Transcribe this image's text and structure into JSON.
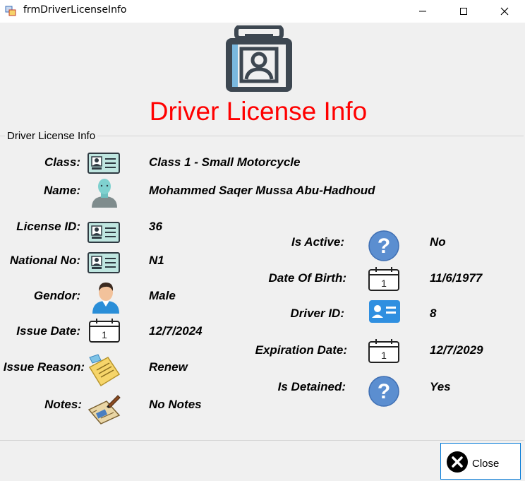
{
  "window": {
    "title": "frmDriverLicenseInfo",
    "controls": {
      "minimize": "minimize-icon",
      "maximize": "maximize-icon",
      "close": "close-icon"
    }
  },
  "header": {
    "title": "Driver License Info",
    "icon": "license-card-icon",
    "title_color": "#ff0000"
  },
  "group": {
    "label": "Driver License Info"
  },
  "left_fields": [
    {
      "label": "Class:",
      "value": "Class 1 - Small Motorcycle",
      "icon": "id-card-icon"
    },
    {
      "label": "Name:",
      "value": "Mohammed Saqer Mussa Abu-Hadhoud",
      "icon": "person-photo-icon"
    },
    {
      "label": "License ID:",
      "value": "36",
      "icon": "id-card-icon"
    },
    {
      "label": "National No:",
      "value": "N1",
      "icon": "id-card-icon"
    },
    {
      "label": "Gendor:",
      "value": "Male",
      "icon": "male-person-icon"
    },
    {
      "label": "Issue Date:",
      "value": "12/7/2024",
      "icon": "calendar-icon"
    },
    {
      "label": "Issue Reason:",
      "value": "Renew",
      "icon": "notepad-icon"
    },
    {
      "label": "Notes:",
      "value": "No Notes",
      "icon": "notes-pen-icon"
    }
  ],
  "right_fields": [
    {
      "label": "Is Active:",
      "value": "No",
      "icon": "question-icon"
    },
    {
      "label": "Date Of Birth:",
      "value": "11/6/1977",
      "icon": "calendar-icon"
    },
    {
      "label": "Driver ID:",
      "value": "8",
      "icon": "driver-card-icon"
    },
    {
      "label": "Expiration Date:",
      "value": "12/7/2029",
      "icon": "calendar-icon"
    },
    {
      "label": "Is Detained:",
      "value": "Yes",
      "icon": "question-icon"
    }
  ],
  "calendar_day": "1",
  "question_mark": "?",
  "footer": {
    "close_label": "Close"
  }
}
